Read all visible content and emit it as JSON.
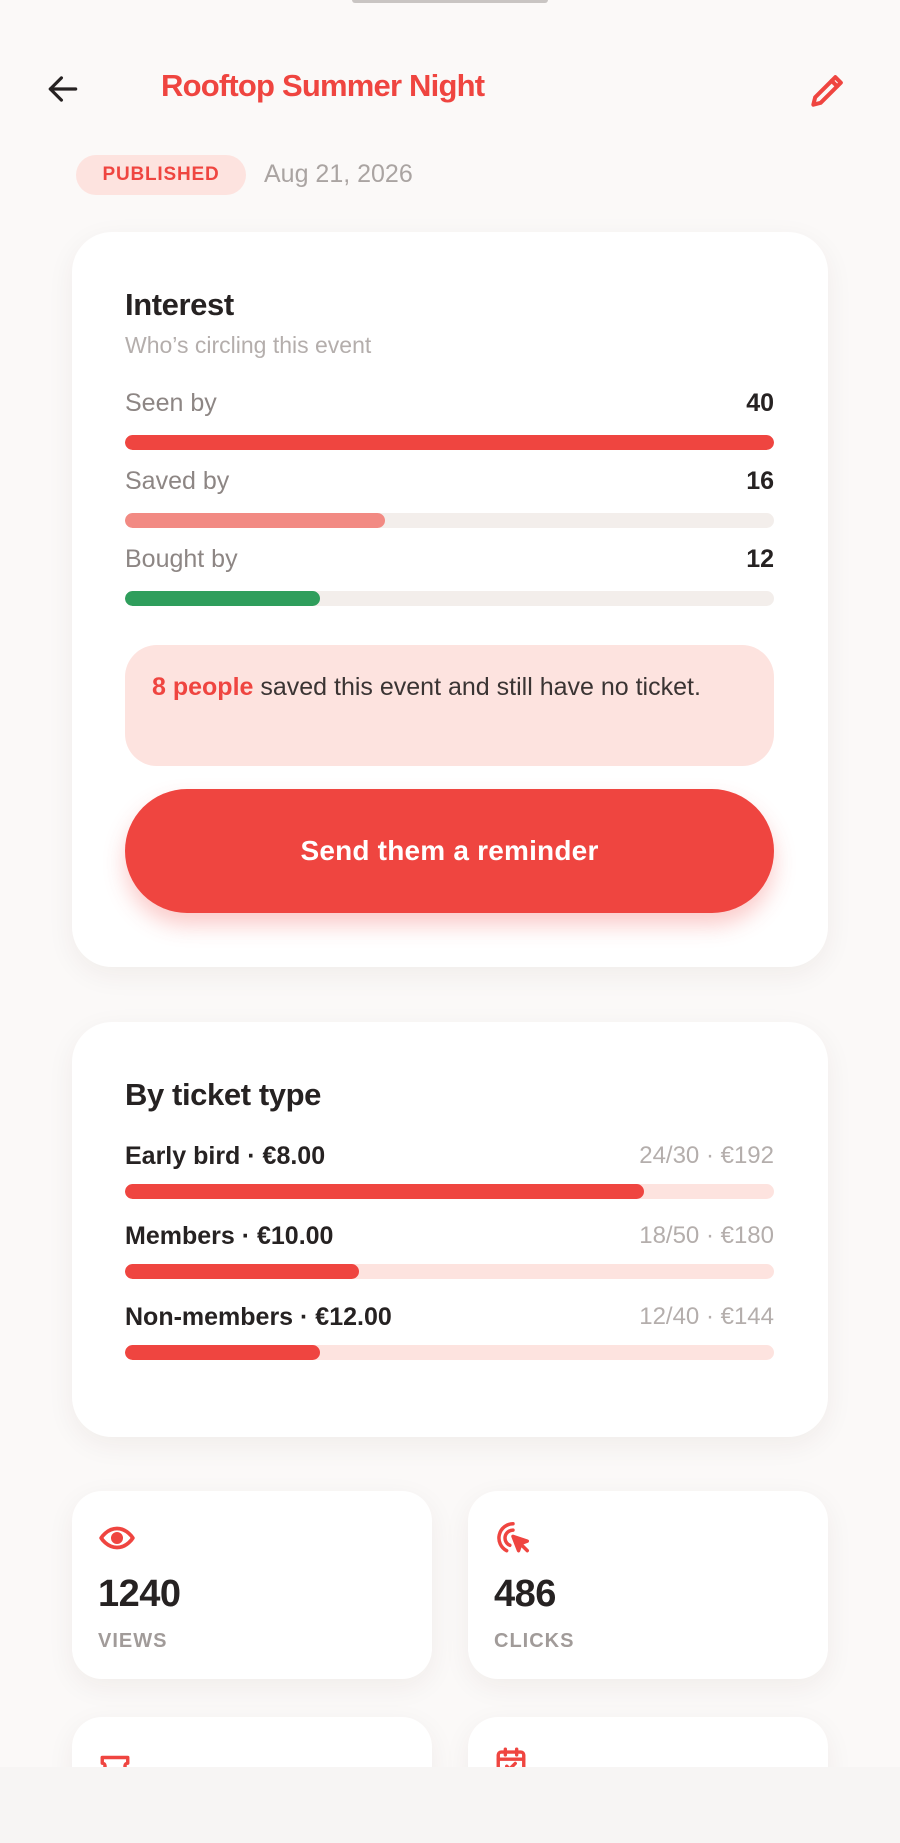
{
  "header": {
    "title": "Rooftop Summer Night",
    "status": "PUBLISHED",
    "date": "Aug 21, 2026",
    "back_icon": "arrow-left-icon",
    "edit_icon": "pencil-icon"
  },
  "interest": {
    "title": "Interest",
    "subtitle": "Who’s circling this event",
    "metrics": [
      {
        "label": "Seen by",
        "value": "40",
        "fraction": 1.0,
        "color": "#ef4540"
      },
      {
        "label": "Saved by",
        "value": "16",
        "fraction": 0.4,
        "color": "#f28a83"
      },
      {
        "label": "Bought by",
        "value": "12",
        "fraction": 0.3,
        "color": "#2f9e5c"
      }
    ],
    "note_highlight": "8 people",
    "note_text": " saved this event and still have no ticket.",
    "button_label": "Send them a reminder"
  },
  "tickets": {
    "title": "By ticket type",
    "rows": [
      {
        "name": "Early bird · €8.00",
        "stats": "24/30 · €192",
        "fraction": 0.8
      },
      {
        "name": "Members · €10.00",
        "stats": "18/50 · €180",
        "fraction": 0.36
      },
      {
        "name": "Non-members · €12.00",
        "stats": "12/40 · €144",
        "fraction": 0.3
      }
    ]
  },
  "stats": [
    {
      "icon": "eye-icon",
      "value": "1240",
      "label": "VIEWS"
    },
    {
      "icon": "cursor-click-icon",
      "value": "486",
      "label": "CLICKS"
    },
    {
      "icon": "ticket-icon"
    },
    {
      "icon": "calendar-check-icon"
    }
  ],
  "colors": {
    "accent": "#ef4540",
    "accent_soft": "#fde3df",
    "success": "#2f9e5c",
    "background": "#fbf9f8"
  }
}
